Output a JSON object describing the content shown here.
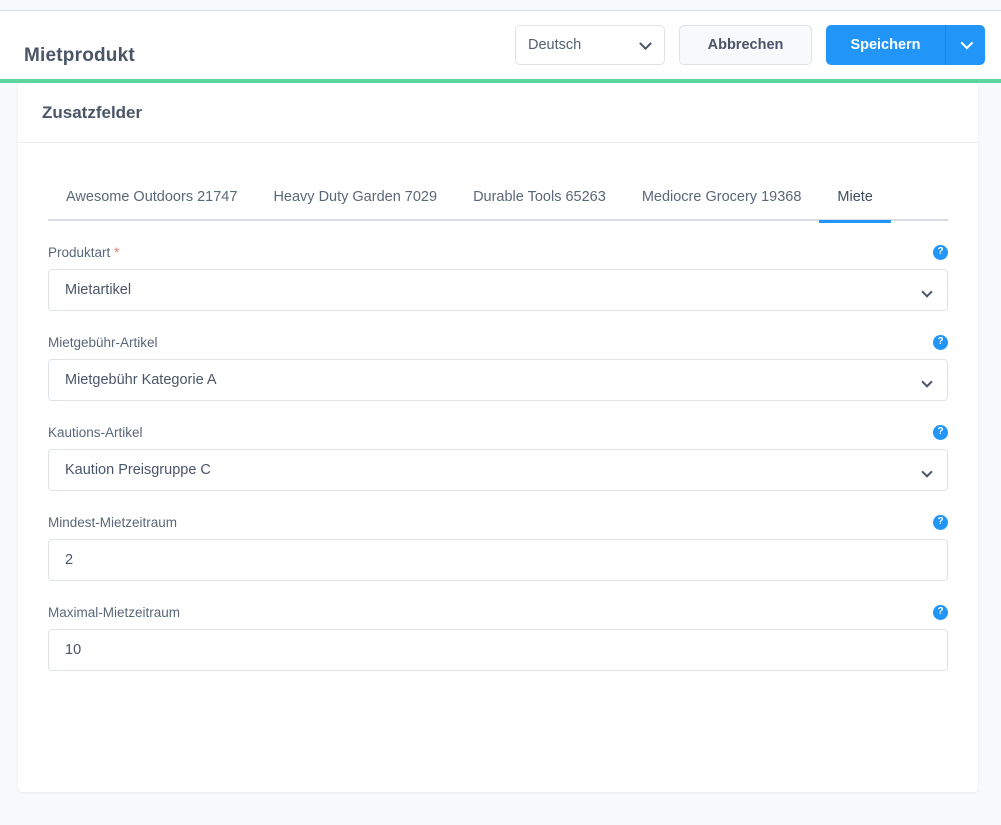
{
  "header": {
    "title": "Mietprodukt",
    "language_select": {
      "value": "Deutsch",
      "icon": "chevron-down-icon"
    },
    "cancel_label": "Abbrechen",
    "save_label": "Speichern",
    "save_dropdown_icon": "chevron-down-icon"
  },
  "colors": {
    "accent_green": "#5cd6a0",
    "primary_blue": "#2196f8",
    "page_background": "#f7f9fb",
    "text": "#4a5568",
    "required_red": "#e8797a"
  },
  "card": {
    "title": "Zusatzfelder"
  },
  "tabs": [
    {
      "label": "Awesome Outdoors 21747",
      "active": false
    },
    {
      "label": "Heavy Duty Garden 7029",
      "active": false
    },
    {
      "label": "Durable Tools 65263",
      "active": false
    },
    {
      "label": "Mediocre Grocery 19368",
      "active": false
    },
    {
      "label": "Miete",
      "active": true
    }
  ],
  "fields": [
    {
      "label": "Produktart",
      "required": true,
      "required_marker": "*",
      "type": "select",
      "value": "Mietartikel",
      "help_icon": "help-icon",
      "help_glyph": "?"
    },
    {
      "label": "Mietgebühr-Artikel",
      "required": false,
      "required_marker": "",
      "type": "select",
      "value": "Mietgebühr Kategorie A",
      "help_icon": "help-icon",
      "help_glyph": "?"
    },
    {
      "label": "Kautions-Artikel",
      "required": false,
      "required_marker": "",
      "type": "select",
      "value": "Kaution Preisgruppe C",
      "help_icon": "help-icon",
      "help_glyph": "?"
    },
    {
      "label": "Mindest-Mietzeitraum",
      "required": false,
      "required_marker": "",
      "type": "text",
      "value": "2",
      "help_icon": "help-icon",
      "help_glyph": "?"
    },
    {
      "label": "Maximal-Mietzeitraum",
      "required": false,
      "required_marker": "",
      "type": "text",
      "value": "10",
      "help_icon": "help-icon",
      "help_glyph": "?"
    }
  ]
}
